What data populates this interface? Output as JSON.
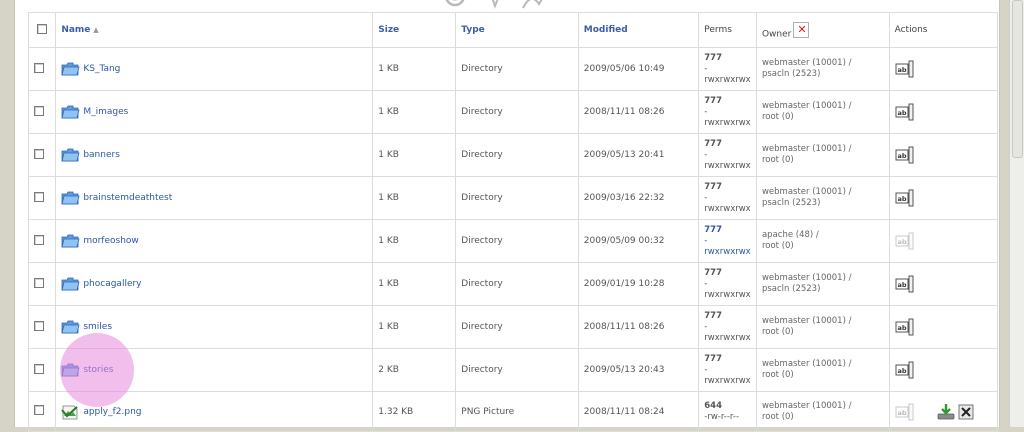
{
  "colors": {
    "link": "#2e56a5",
    "highlight": "#e88ade",
    "page_bg": "#ffffff",
    "chrome_bg": "#d6d3c7"
  },
  "header": {
    "name_label": "Name",
    "sort_indicator": "▲",
    "size_label": "Size",
    "type_label": "Type",
    "modified_label": "Modified",
    "perms_label": "Perms",
    "owner_label": "Owner",
    "actions_label": "Actions"
  },
  "rows": [
    {
      "name": "KS_Tang",
      "size": "1 KB",
      "type": "Directory",
      "modified": "2009/05/06 10:49",
      "perm_num": "777",
      "perm_sep": "-",
      "perm_str": "rwxrwxrwx",
      "owner_user": "webmaster (10001) /",
      "owner_group": "psacln (2523)",
      "icon": "folder-icon"
    },
    {
      "name": "M_images",
      "size": "1 KB",
      "type": "Directory",
      "modified": "2008/11/11 08:26",
      "perm_num": "777",
      "perm_sep": "-",
      "perm_str": "rwxrwxrwx",
      "owner_user": "webmaster (10001) /",
      "owner_group": "root (0)",
      "icon": "folder-icon"
    },
    {
      "name": "banners",
      "size": "1 KB",
      "type": "Directory",
      "modified": "2009/05/13 20:41",
      "perm_num": "777",
      "perm_sep": "-",
      "perm_str": "rwxrwxrwx",
      "owner_user": "webmaster (10001) /",
      "owner_group": "root (0)",
      "icon": "folder-icon"
    },
    {
      "name": "brainstemdeathtest",
      "size": "1 KB",
      "type": "Directory",
      "modified": "2009/03/16 22:32",
      "perm_num": "777",
      "perm_sep": "-",
      "perm_str": "rwxrwxrwx",
      "owner_user": "webmaster (10001) /",
      "owner_group": "psacln (2523)",
      "icon": "folder-icon"
    },
    {
      "name": "morfeoshow",
      "size": "1 KB",
      "type": "Directory",
      "modified": "2009/05/09 00:32",
      "perm_num": "777",
      "perm_sep": "-",
      "perm_str": "rwxrwxrwx",
      "owner_user": "apache (48) /",
      "owner_group": "root (0)",
      "icon": "folder-icon"
    },
    {
      "name": "phocagallery",
      "size": "1 KB",
      "type": "Directory",
      "modified": "2009/01/19 10:28",
      "perm_num": "777",
      "perm_sep": "-",
      "perm_str": "rwxrwxrwx",
      "owner_user": "webmaster (10001) /",
      "owner_group": "psacln (2523)",
      "icon": "folder-icon"
    },
    {
      "name": "smiles",
      "size": "1 KB",
      "type": "Directory",
      "modified": "2008/11/11 08:26",
      "perm_num": "777",
      "perm_sep": "-",
      "perm_str": "rwxrwxrwx",
      "owner_user": "webmaster (10001) /",
      "owner_group": "root (0)",
      "icon": "folder-icon"
    },
    {
      "name": "stories",
      "size": "2 KB",
      "type": "Directory",
      "modified": "2009/05/13 20:43",
      "perm_num": "777",
      "perm_sep": "-",
      "perm_str": "rwxrwxrwx",
      "owner_user": "webmaster (10001) /",
      "owner_group": "root (0)",
      "icon": "folder-icon"
    },
    {
      "name": "apply_f2.png",
      "size": "1.32 KB",
      "type": "PNG Picture",
      "modified": "2008/11/11 08:24",
      "perm_num": "644",
      "perm_sep": "",
      "perm_str": "-rw-r--r--",
      "owner_user": "webmaster (10001) /",
      "owner_group": "root (0)",
      "icon": "image-file-icon"
    }
  ]
}
